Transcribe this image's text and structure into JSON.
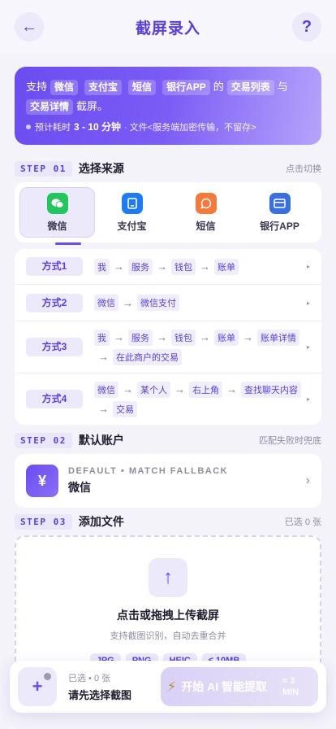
{
  "header": {
    "back_icon": "←",
    "title": "截屏录入",
    "help_icon": "?"
  },
  "banner": {
    "t1": "支持",
    "c1": "微信",
    "c2": "支付宝",
    "c3": "短信",
    "c4": "银行APP",
    "t2": "的",
    "c5": "交易列表",
    "t3": "与",
    "c6": "交易详情",
    "t4": "截屏。",
    "meta_prefix": "预计耗时",
    "meta_time": "3 - 10 分钟",
    "meta_suffix": "· 文件<服务端加密传输，不留存>"
  },
  "step1": {
    "tag": "STEP 01",
    "title": "选择来源",
    "hint": "点击切换"
  },
  "sources": [
    {
      "label": "微信",
      "icon": "wechat-icon",
      "color": "#22c55e"
    },
    {
      "label": "支付宝",
      "icon": "alipay-icon",
      "color": "#1e7bf5"
    },
    {
      "label": "短信",
      "icon": "sms-icon",
      "color": "#f5793a"
    },
    {
      "label": "银行APP",
      "icon": "bank-card-icon",
      "color": "#3b6fe0"
    }
  ],
  "methods": [
    {
      "label": "方式1",
      "line1": [
        "我",
        "服务",
        "钱包",
        "账单"
      ]
    },
    {
      "label": "方式2",
      "line1": [
        "微信",
        "微信支付"
      ]
    },
    {
      "label": "方式3",
      "line1": [
        "我",
        "服务",
        "钱包",
        "账单"
      ],
      "line2": [
        "账单详情",
        "在此商户的交易"
      ]
    },
    {
      "label": "方式4",
      "line1": [
        "微信",
        "某个人",
        "右上角"
      ],
      "line2": [
        "查找聊天内容",
        "交易"
      ]
    }
  ],
  "step2": {
    "tag": "STEP 02",
    "title": "默认账户",
    "hint": "匹配失败时兜底"
  },
  "account": {
    "icon": "¥",
    "sub": "DEFAULT • MATCH FALLBACK",
    "name": "微信"
  },
  "step3": {
    "tag": "STEP 03",
    "title": "添加文件",
    "hint": "已选 0 张"
  },
  "upload": {
    "icon": "↑",
    "title": "点击或拖拽上传截屏",
    "sub": "支持截图识别，自动去重合并",
    "formats": [
      "JPG",
      "PNG",
      "HEIC",
      "≤ 10MB"
    ]
  },
  "bottom": {
    "add": "+",
    "count": "已选 • 0 张",
    "hint": "请先选择截图",
    "start_label": "开始 AI 智能提取",
    "eta": "≈ 3 MIN"
  }
}
